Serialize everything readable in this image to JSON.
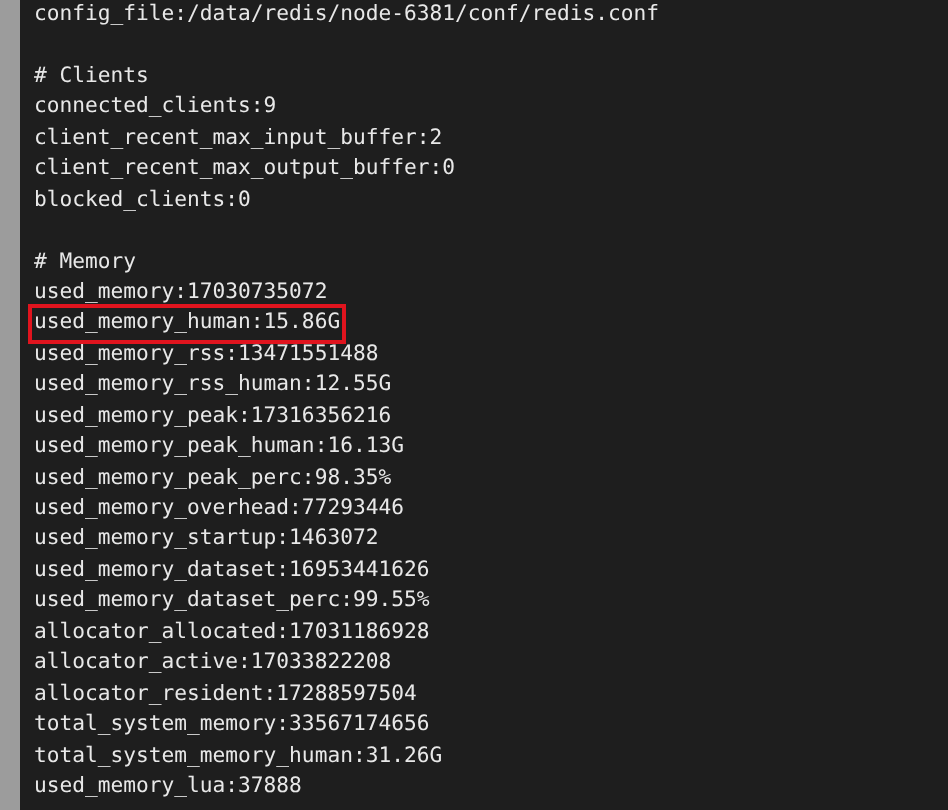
{
  "terminal": {
    "lines": [
      {
        "kind": "text",
        "text": "config_file:/data/redis/node-6381/conf/redis.conf",
        "highlighted": false
      },
      {
        "kind": "blank"
      },
      {
        "kind": "comment",
        "text": "# Clients",
        "highlighted": false
      },
      {
        "kind": "text",
        "text": "connected_clients:9",
        "highlighted": false
      },
      {
        "kind": "text",
        "text": "client_recent_max_input_buffer:2",
        "highlighted": false
      },
      {
        "kind": "text",
        "text": "client_recent_max_output_buffer:0",
        "highlighted": false
      },
      {
        "kind": "text",
        "text": "blocked_clients:0",
        "highlighted": false
      },
      {
        "kind": "blank"
      },
      {
        "kind": "comment",
        "text": "# Memory",
        "highlighted": false
      },
      {
        "kind": "text",
        "text": "used_memory:17030735072",
        "highlighted": false
      },
      {
        "kind": "text",
        "text": "used_memory_human:15.86G",
        "highlighted": true
      },
      {
        "kind": "text",
        "text": "used_memory_rss:13471551488",
        "highlighted": false
      },
      {
        "kind": "text",
        "text": "used_memory_rss_human:12.55G",
        "highlighted": false
      },
      {
        "kind": "text",
        "text": "used_memory_peak:17316356216",
        "highlighted": false
      },
      {
        "kind": "text",
        "text": "used_memory_peak_human:16.13G",
        "highlighted": false
      },
      {
        "kind": "text",
        "text": "used_memory_peak_perc:98.35%",
        "highlighted": false
      },
      {
        "kind": "text",
        "text": "used_memory_overhead:77293446",
        "highlighted": false
      },
      {
        "kind": "text",
        "text": "used_memory_startup:1463072",
        "highlighted": false
      },
      {
        "kind": "text",
        "text": "used_memory_dataset:16953441626",
        "highlighted": false
      },
      {
        "kind": "text",
        "text": "used_memory_dataset_perc:99.55%",
        "highlighted": false
      },
      {
        "kind": "text",
        "text": "allocator_allocated:17031186928",
        "highlighted": false
      },
      {
        "kind": "text",
        "text": "allocator_active:17033822208",
        "highlighted": false
      },
      {
        "kind": "text",
        "text": "allocator_resident:17288597504",
        "highlighted": false
      },
      {
        "kind": "text",
        "text": "total_system_memory:33567174656",
        "highlighted": false
      },
      {
        "kind": "text",
        "text": "total_system_memory_human:31.26G",
        "highlighted": false
      },
      {
        "kind": "text",
        "text": "used_memory_lua:37888",
        "highlighted": false
      }
    ]
  }
}
